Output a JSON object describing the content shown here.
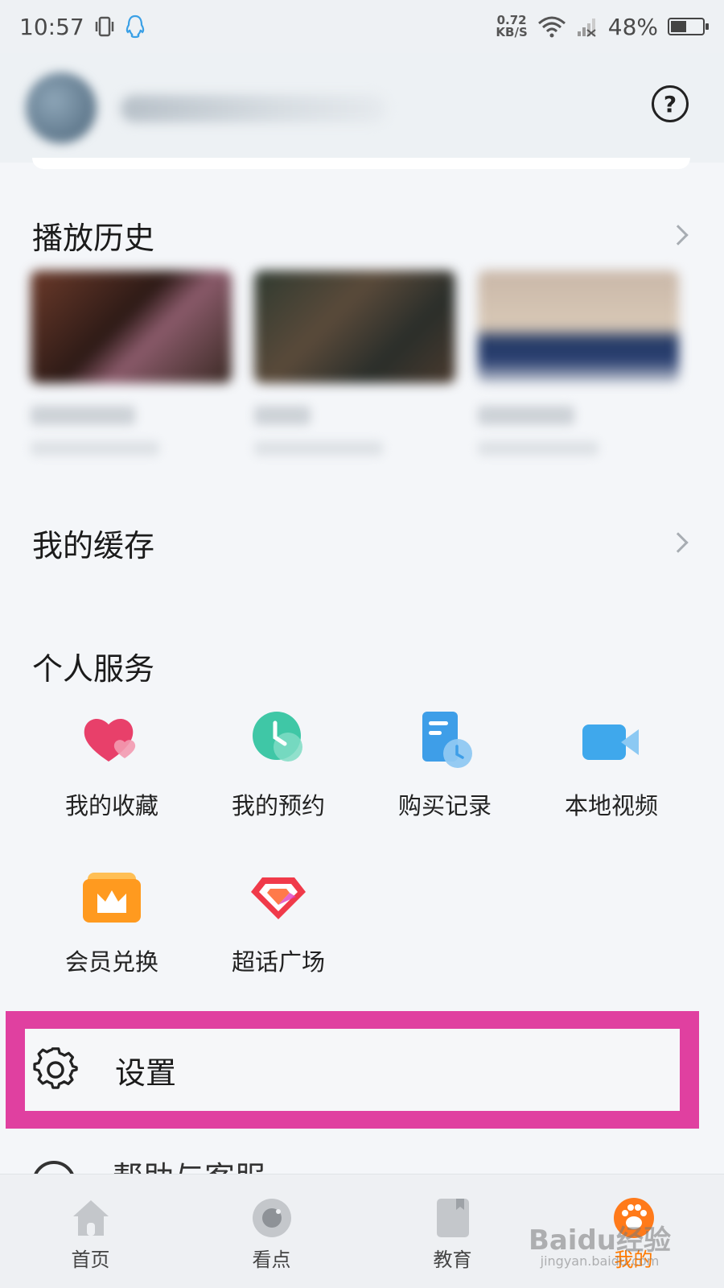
{
  "status_bar": {
    "time": "10:57",
    "net_speed_value": "0.72",
    "net_speed_unit": "KB/S",
    "battery": "48%"
  },
  "header": {
    "help_icon": "?"
  },
  "history": {
    "title": "播放历史"
  },
  "downloads": {
    "title": "我的缓存"
  },
  "services": {
    "title": "个人服务",
    "items": [
      {
        "label": "我的收藏",
        "icon": "heart-icon"
      },
      {
        "label": "我的预约",
        "icon": "clock-icon"
      },
      {
        "label": "购买记录",
        "icon": "receipt-icon"
      },
      {
        "label": "本地视频",
        "icon": "video-camera-icon"
      },
      {
        "label": "会员兑换",
        "icon": "crown-icon"
      },
      {
        "label": "超话广场",
        "icon": "diamond-icon"
      }
    ]
  },
  "settings": {
    "label": "设置"
  },
  "next_row": {
    "label": "帮助与客服"
  },
  "tabs": [
    {
      "label": "首页",
      "icon": "home-icon"
    },
    {
      "label": "看点",
      "icon": "camera-lens-icon"
    },
    {
      "label": "教育",
      "icon": "book-icon"
    },
    {
      "label": "我的",
      "icon": "paw-icon",
      "active": true
    }
  ],
  "watermark": {
    "brand": "Baidu经验",
    "url": "jingyan.baidu.com"
  },
  "colors": {
    "highlight": "#e040a0",
    "active_tab": "#ff7a00"
  }
}
